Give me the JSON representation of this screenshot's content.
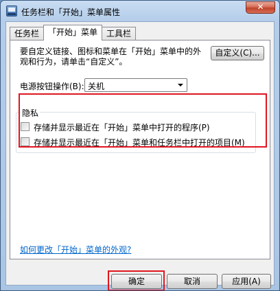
{
  "window": {
    "title": "任务栏和「开始」菜单属性",
    "close_label": "✕"
  },
  "tabs": [
    {
      "label": "任务栏",
      "active": false
    },
    {
      "label": "「开始」菜单",
      "active": true
    },
    {
      "label": "工具栏",
      "active": false
    }
  ],
  "start_menu": {
    "instructions": "要自定义链接、图标和菜单在「开始」菜单中的外观和行为，请单击“自定义”。",
    "customize_button": "自定义(C)...",
    "power_label": "电源按钮操作(B):",
    "power_value": "关机",
    "privacy": {
      "title": "隐私",
      "options": [
        {
          "label": "存储并显示最近在「开始」菜单中打开的程序(P)",
          "checked": false
        },
        {
          "label": "存储并显示最近在「开始」菜单和任务栏中打开的项目(M)",
          "checked": false
        }
      ]
    },
    "help_link": "如何更改「开始」菜单的外观?"
  },
  "footer": {
    "ok": "确定",
    "cancel": "取消",
    "apply": "应用(A)"
  },
  "colors": {
    "highlight": "#e0141e",
    "link": "#0066cc"
  }
}
